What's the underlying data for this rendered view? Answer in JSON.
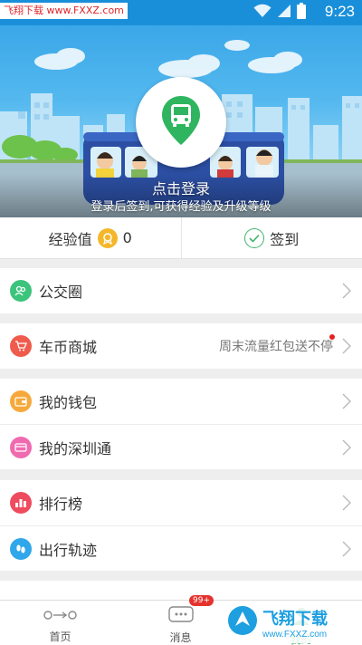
{
  "status_bar": {
    "watermark": "飞翔下载 www.FXXZ.com",
    "time": "9:23",
    "icons": [
      "wifi-icon",
      "signal-icon",
      "battery-icon"
    ]
  },
  "banner": {
    "login_title": "点击登录",
    "login_subtitle": "登录后签到,可获得经验及升级等级",
    "logo_icon": "bus-pin-icon"
  },
  "stats": {
    "exp_label": "经验值",
    "exp_value": "0",
    "checkin_label": "签到"
  },
  "menu": {
    "groups": [
      {
        "items": [
          {
            "label": "公交圈",
            "icon": "people-icon",
            "color": "#3cc47c"
          }
        ]
      },
      {
        "items": [
          {
            "label": "车币商城",
            "icon": "cart-icon",
            "color": "#ef5b4c",
            "extra": "周末流量红包送不停",
            "dot": true
          }
        ]
      },
      {
        "items": [
          {
            "label": "我的钱包",
            "icon": "wallet-icon",
            "color": "#f6a93b"
          },
          {
            "label": "我的深圳通",
            "icon": "card-icon",
            "color": "#f06ab0"
          }
        ]
      },
      {
        "items": [
          {
            "label": "排行榜",
            "icon": "ranking-icon",
            "color": "#ef4b5e"
          },
          {
            "label": "出行轨迹",
            "icon": "footprint-icon",
            "color": "#2fa7ea"
          }
        ]
      }
    ]
  },
  "tabbar": {
    "tabs": [
      {
        "label": "首页",
        "icon": "route-icon"
      },
      {
        "label": "消息",
        "icon": "chat-icon",
        "badge": "99+"
      },
      {
        "label": "我的",
        "icon": "user-icon",
        "active": true
      }
    ]
  },
  "watermark_bottom": {
    "big": "飞翔下载",
    "small": "www.FXXZ.com"
  },
  "colors": {
    "status_bar": "#1a8fd9",
    "accent_green": "#3fb36b",
    "coin": "#f5b72a"
  }
}
